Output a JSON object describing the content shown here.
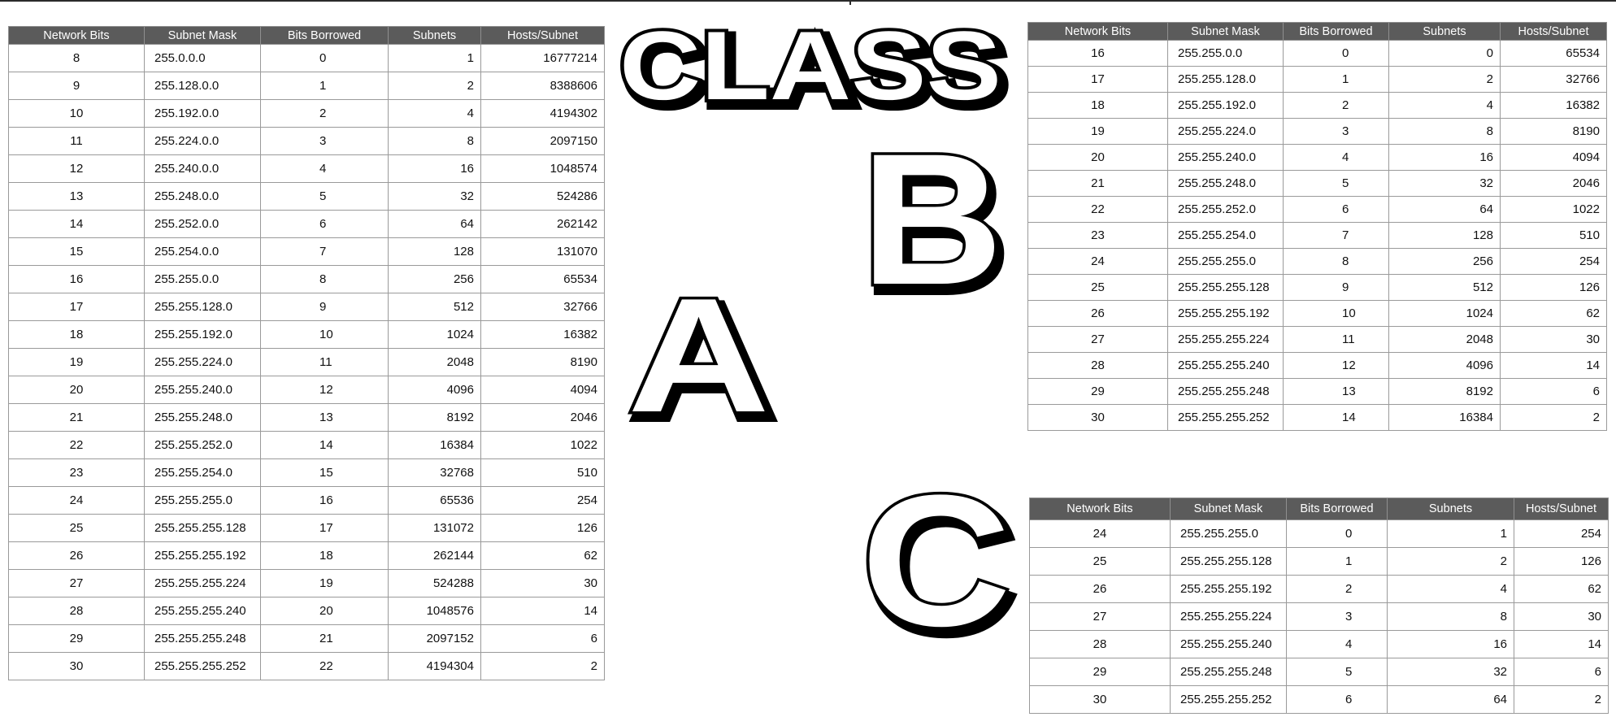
{
  "art": {
    "class_word": "CLASS",
    "letter_a": "A",
    "letter_b": "B",
    "letter_c": "C"
  },
  "columns": [
    "Network Bits",
    "Subnet Mask",
    "Bits Borrowed",
    "Subnets",
    "Hosts/Subnet"
  ],
  "class_a": {
    "rows": [
      [
        "8",
        "255.0.0.0",
        "0",
        "1",
        "16777214"
      ],
      [
        "9",
        "255.128.0.0",
        "1",
        "2",
        "8388606"
      ],
      [
        "10",
        "255.192.0.0",
        "2",
        "4",
        "4194302"
      ],
      [
        "11",
        "255.224.0.0",
        "3",
        "8",
        "2097150"
      ],
      [
        "12",
        "255.240.0.0",
        "4",
        "16",
        "1048574"
      ],
      [
        "13",
        "255.248.0.0",
        "5",
        "32",
        "524286"
      ],
      [
        "14",
        "255.252.0.0",
        "6",
        "64",
        "262142"
      ],
      [
        "15",
        "255.254.0.0",
        "7",
        "128",
        "131070"
      ],
      [
        "16",
        "255.255.0.0",
        "8",
        "256",
        "65534"
      ],
      [
        "17",
        "255.255.128.0",
        "9",
        "512",
        "32766"
      ],
      [
        "18",
        "255.255.192.0",
        "10",
        "1024",
        "16382"
      ],
      [
        "19",
        "255.255.224.0",
        "11",
        "2048",
        "8190"
      ],
      [
        "20",
        "255.255.240.0",
        "12",
        "4096",
        "4094"
      ],
      [
        "21",
        "255.255.248.0",
        "13",
        "8192",
        "2046"
      ],
      [
        "22",
        "255.255.252.0",
        "14",
        "16384",
        "1022"
      ],
      [
        "23",
        "255.255.254.0",
        "15",
        "32768",
        "510"
      ],
      [
        "24",
        "255.255.255.0",
        "16",
        "65536",
        "254"
      ],
      [
        "25",
        "255.255.255.128",
        "17",
        "131072",
        "126"
      ],
      [
        "26",
        "255.255.255.192",
        "18",
        "262144",
        "62"
      ],
      [
        "27",
        "255.255.255.224",
        "19",
        "524288",
        "30"
      ],
      [
        "28",
        "255.255.255.240",
        "20",
        "1048576",
        "14"
      ],
      [
        "29",
        "255.255.255.248",
        "21",
        "2097152",
        "6"
      ],
      [
        "30",
        "255.255.255.252",
        "22",
        "4194304",
        "2"
      ]
    ]
  },
  "class_b": {
    "rows": [
      [
        "16",
        "255.255.0.0",
        "0",
        "0",
        "65534"
      ],
      [
        "17",
        "255.255.128.0",
        "1",
        "2",
        "32766"
      ],
      [
        "18",
        "255.255.192.0",
        "2",
        "4",
        "16382"
      ],
      [
        "19",
        "255.255.224.0",
        "3",
        "8",
        "8190"
      ],
      [
        "20",
        "255.255.240.0",
        "4",
        "16",
        "4094"
      ],
      [
        "21",
        "255.255.248.0",
        "5",
        "32",
        "2046"
      ],
      [
        "22",
        "255.255.252.0",
        "6",
        "64",
        "1022"
      ],
      [
        "23",
        "255.255.254.0",
        "7",
        "128",
        "510"
      ],
      [
        "24",
        "255.255.255.0",
        "8",
        "256",
        "254"
      ],
      [
        "25",
        "255.255.255.128",
        "9",
        "512",
        "126"
      ],
      [
        "26",
        "255.255.255.192",
        "10",
        "1024",
        "62"
      ],
      [
        "27",
        "255.255.255.224",
        "11",
        "2048",
        "30"
      ],
      [
        "28",
        "255.255.255.240",
        "12",
        "4096",
        "14"
      ],
      [
        "29",
        "255.255.255.248",
        "13",
        "8192",
        "6"
      ],
      [
        "30",
        "255.255.255.252",
        "14",
        "16384",
        "2"
      ]
    ]
  },
  "class_c": {
    "rows": [
      [
        "24",
        "255.255.255.0",
        "0",
        "1",
        "254"
      ],
      [
        "25",
        "255.255.255.128",
        "1",
        "2",
        "126"
      ],
      [
        "26",
        "255.255.255.192",
        "2",
        "4",
        "62"
      ],
      [
        "27",
        "255.255.255.224",
        "3",
        "8",
        "30"
      ],
      [
        "28",
        "255.255.255.240",
        "4",
        "16",
        "14"
      ],
      [
        "29",
        "255.255.255.248",
        "5",
        "32",
        "6"
      ],
      [
        "30",
        "255.255.255.252",
        "6",
        "64",
        "2"
      ]
    ]
  }
}
